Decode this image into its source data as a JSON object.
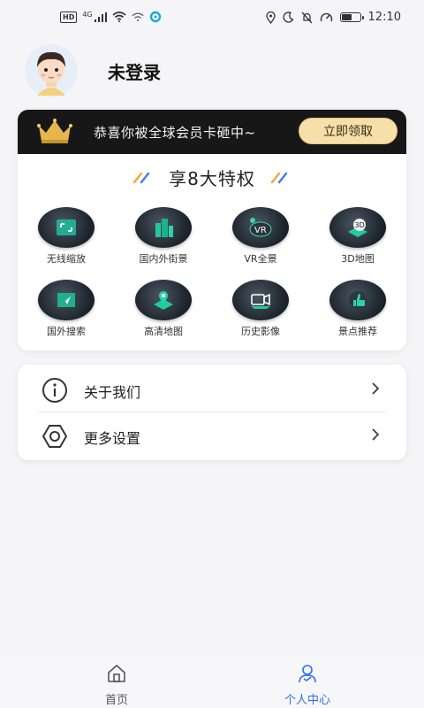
{
  "status_bar": {
    "network_badge": "HD",
    "network_type": "4G",
    "time": "12:10",
    "battery_level": 0.6
  },
  "profile": {
    "username": "未登录"
  },
  "vip": {
    "banner_text": "恭喜你被全球会员卡砸中~",
    "claim_button": "立即领取",
    "privileges_title": "享8大特权",
    "features": [
      {
        "label": "无线缩放",
        "icon": "zoom-icon"
      },
      {
        "label": "国内外街景",
        "icon": "street-view-icon"
      },
      {
        "label": "VR全景",
        "icon": "vr-icon"
      },
      {
        "label": "3D地图",
        "icon": "3d-map-icon"
      },
      {
        "label": "国外搜索",
        "icon": "search-navigation-icon"
      },
      {
        "label": "高清地图",
        "icon": "hd-map-icon"
      },
      {
        "label": "历史影像",
        "icon": "history-video-icon"
      },
      {
        "label": "景点推荐",
        "icon": "thumbs-up-icon"
      }
    ],
    "feature_3d_tag": "3D",
    "feature_vr_tag": "VR"
  },
  "menu": {
    "items": [
      {
        "label": "关于我们",
        "icon": "info-icon"
      },
      {
        "label": "更多设置",
        "icon": "settings-icon"
      }
    ]
  },
  "tabbar": {
    "tabs": [
      {
        "label": "首页",
        "icon": "home-icon",
        "active": false
      },
      {
        "label": "个人中心",
        "icon": "user-icon",
        "active": true
      }
    ],
    "active_color": "#2f6df0",
    "inactive_color": "#555555"
  },
  "colors": {
    "banner_bg": "#171717",
    "claim_button_bg": "#f6dfa9",
    "accent_blue": "#2f6df0"
  }
}
